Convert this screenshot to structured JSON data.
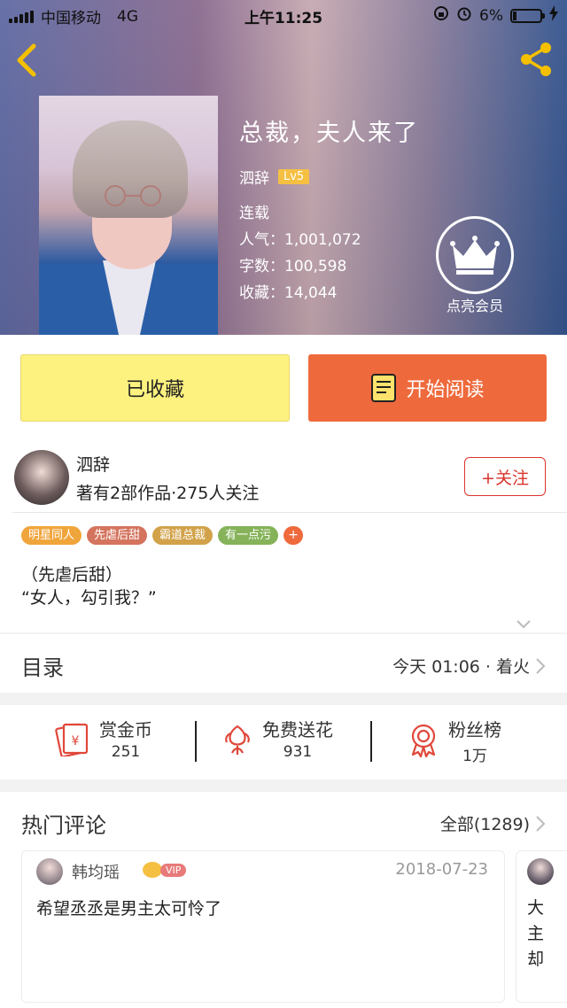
{
  "status_bar": {
    "carrier": "中国移动",
    "network": "4G",
    "time": "上午11:25",
    "battery_percent": "6%"
  },
  "book": {
    "title": "总裁，夫人来了",
    "author": "泗辞",
    "level": "Lv5",
    "status": "连载",
    "popularity": "人气：1,001,072",
    "word_count": "字数：100,598",
    "favorites": "收藏：14,044"
  },
  "vip": {
    "label": "点亮会员"
  },
  "actions": {
    "favorite_label": "已收藏",
    "read_label": "开始阅读"
  },
  "author_card": {
    "name": "泗辞",
    "stats": "著有2部作品·275人关注",
    "follow_label": "+关注"
  },
  "tags": [
    {
      "label": "明星同人",
      "color": "#f0a53c"
    },
    {
      "label": "先虐后甜",
      "color": "#d4745e"
    },
    {
      "label": "霸道总裁",
      "color": "#d2a24a"
    },
    {
      "label": "有一点污",
      "color": "#86b35a"
    }
  ],
  "tag_more": "+",
  "description": {
    "line1": "（先虐后甜）",
    "line2": "“女人，勾引我？”"
  },
  "toc": {
    "title": "目录",
    "latest": "今天 01:06 · 着火"
  },
  "stats": [
    {
      "label": "赏金币",
      "value": "251"
    },
    {
      "label": "免费送花",
      "value": "931"
    },
    {
      "label": "粉丝榜",
      "value": "1万"
    }
  ],
  "comments": {
    "title": "热门评论",
    "all_label": "全部(1289)",
    "items": [
      {
        "user": "韩均瑶",
        "badge": "VIP",
        "date": "2018-07-23",
        "text": "希望丞丞是男主太可怜了"
      },
      {
        "text": "大主却"
      }
    ]
  },
  "colors": {
    "accent_orange": "#ee6a3c",
    "favorite_yellow": "#fdf27f",
    "follow_red": "#d9342b",
    "level_gold": "#f5c042"
  }
}
